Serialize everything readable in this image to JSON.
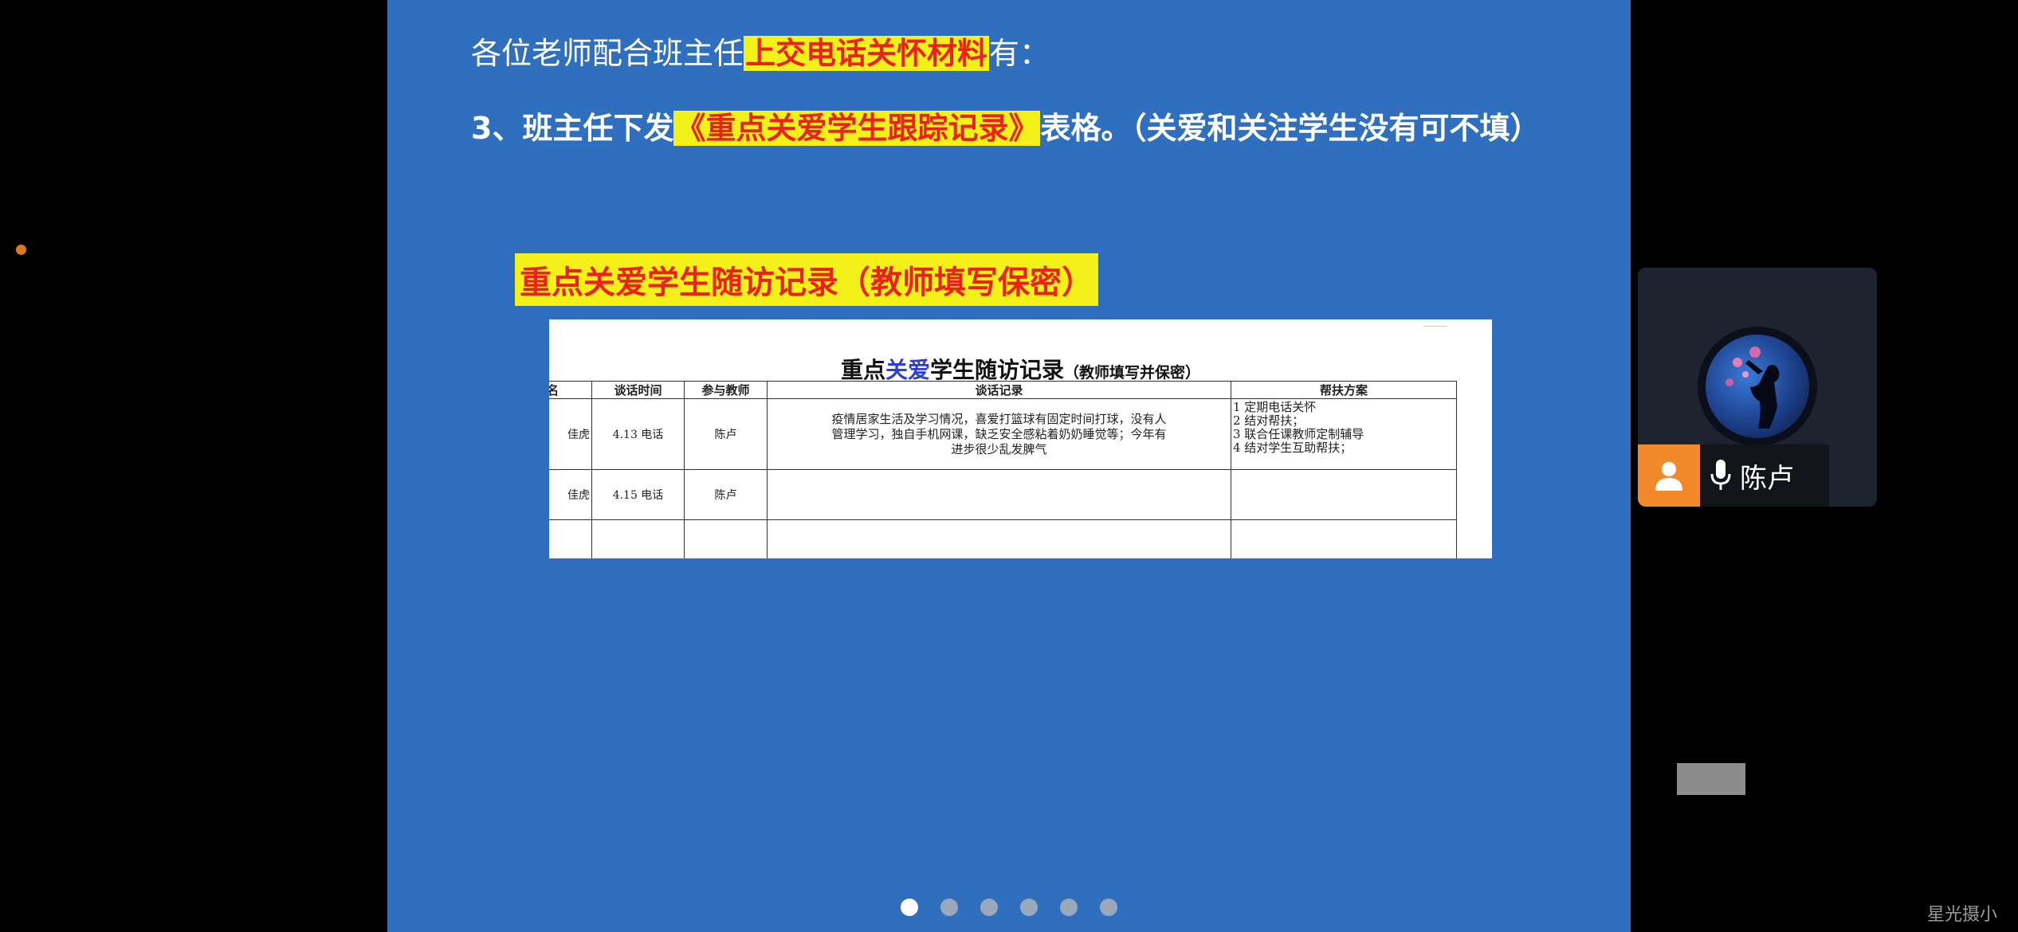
{
  "slide": {
    "line1": {
      "prefix": "各位老师配合班主任",
      "highlight": "上交电话关怀材料",
      "suffix": "有："
    },
    "line2": {
      "prefix": "3、班主任下发",
      "highlight": "《重点关爱学生跟踪记录》",
      "suffix": "表格。（关爱和关注学生没有可不填）"
    },
    "subheading": "重点关爱学生随访记录（教师填写保密）",
    "document": {
      "title_part1": "重点",
      "title_part2": "关爱",
      "title_part3": "学生随访记录",
      "title_note": "（教师填写并保密）",
      "headers": [
        "姓名",
        "谈话时间",
        "参与教师",
        "谈话记录",
        "帮扶方案"
      ],
      "rows": [
        {
          "name": "佳虎",
          "time": "4.13 电话",
          "teacher": "陈卢",
          "record_lines": [
            "疫情居家生活及学习情况，喜爱打篮球有固定时间打球，没有人",
            "管理学习，独自手机网课，缺乏安全感粘着奶奶睡觉等；今年有",
            "进步很少乱发脾气"
          ],
          "plan_lines": [
            "1 定期电话关怀",
            "2 结对帮扶；",
            "3 联合任课教师定制辅导",
            "4 结对学生互助帮扶；"
          ]
        },
        {
          "name": "佳虎",
          "time": "4.15 电话",
          "teacher": "陈卢",
          "record_lines": [],
          "plan_lines": []
        }
      ],
      "add_button": "+"
    },
    "page_indicator": {
      "total": 6,
      "active_index": 0
    }
  },
  "participant": {
    "name": "陈卢",
    "mic_status": "on"
  },
  "watermark": "星光摄小",
  "colors": {
    "slide_background": "#2f6fbd",
    "highlight_background": "#f4f01a",
    "highlight_text": "#e8231b",
    "participant_badge": "#f08a2a"
  }
}
